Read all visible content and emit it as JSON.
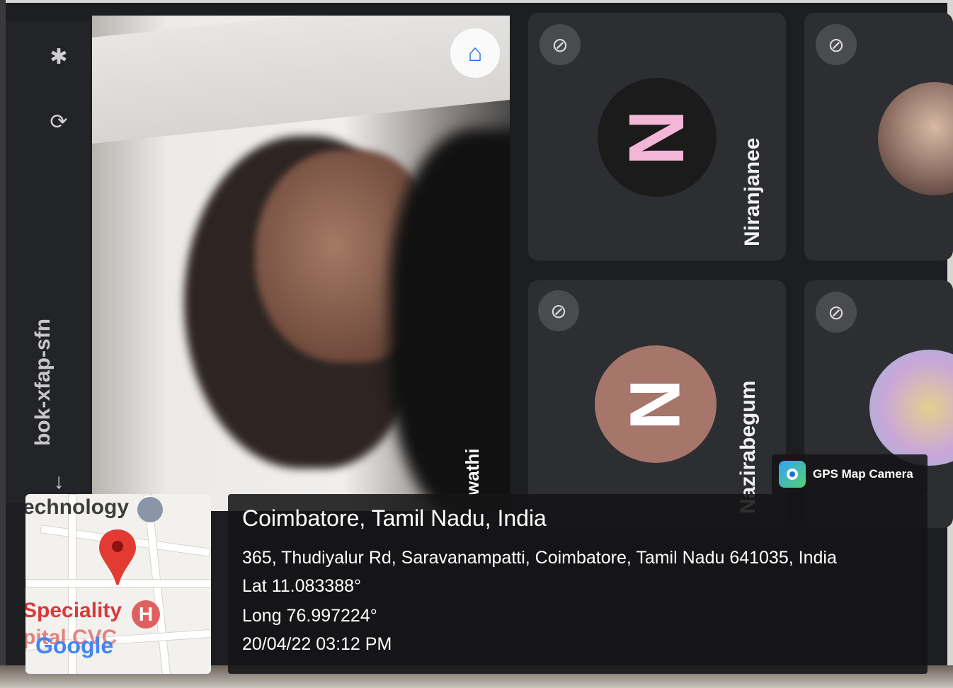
{
  "side_toolbar": {
    "meeting_code": "bok-xfap-sfn",
    "icons": [
      "bluetooth-icon",
      "rotate-camera-icon",
      "arrow-icon"
    ]
  },
  "self_tile": {
    "name_partial": "wathi",
    "button_icon": "microphone-icon"
  },
  "participants": [
    {
      "name": "Niranjanee",
      "initial": "N",
      "avatar_bg": "#1b1b1b",
      "initial_color": "#f4b6d6",
      "mic_icon": "mic-off-icon"
    },
    {
      "name": "",
      "initial": "",
      "avatar_bg": "#8b6c62",
      "mic_icon": "mic-off-icon"
    },
    {
      "name": "Nazirabegum",
      "initial": "N",
      "avatar_bg": "#a6766a",
      "initial_color": "#ffffff",
      "mic_icon": "mic-off-icon"
    },
    {
      "name": "",
      "initial": "",
      "avatar_bg": "#c9a7d8",
      "mic_icon": "mic-off-icon"
    }
  ],
  "gps_badge": {
    "label": "GPS Map Camera",
    "icon": "gps-camera-icon"
  },
  "map": {
    "text_top": "echnology",
    "text_hospital": "Speciality",
    "text_bottom": "pital CVC",
    "google": "Google",
    "hospital_glyph": "H"
  },
  "location": {
    "title": "Coimbatore, Tamil Nadu, India",
    "address": "365, Thudiyalur Rd, Saravanampatti, Coimbatore, Tamil Nadu 641035, India",
    "lat": "Lat 11.083388°",
    "long": "Long 76.997224°",
    "timestamp": "20/04/22 03:12 PM"
  }
}
